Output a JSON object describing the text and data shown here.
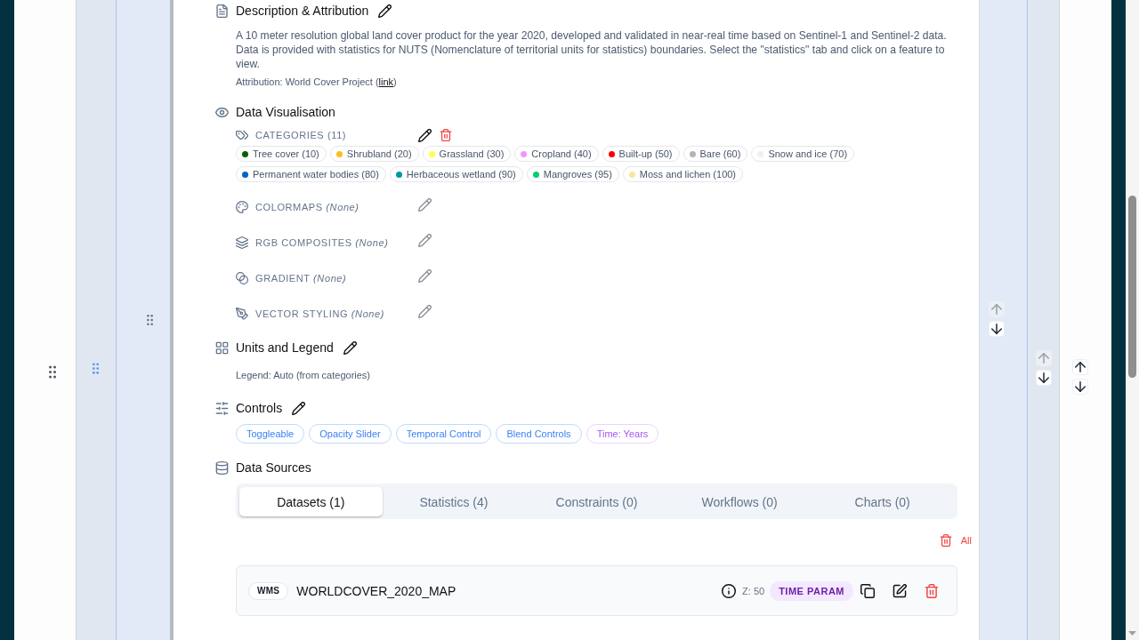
{
  "group": {
    "move_buttons": [
      {
        "kind": "up",
        "disabled": false
      },
      {
        "kind": "down",
        "disabled": false
      }
    ],
    "subgroup": {
      "move_buttons": [
        {
          "kind": "up",
          "disabled": true
        },
        {
          "kind": "down",
          "disabled": false
        }
      ],
      "layer": {
        "move_buttons": [
          {
            "kind": "up",
            "disabled": true
          },
          {
            "kind": "down",
            "disabled": false
          }
        ],
        "description": {
          "title": "Description & Attribution",
          "text": "A 10 meter resolution global land cover product for the year 2020, developed and validated in near-real time based on Sentinel-1 and Sentinel-2 data. Data is provided with statistics for NUTS (Nomenclature of territorial units for statistics) boundaries. Select the \"statistics\" tab and click on a feature to view.",
          "attribution": {
            "prefix": "Attribution: World Cover Project (",
            "link": "link",
            "suffix": ")"
          }
        },
        "visualisation": {
          "title": "Data Visualisation",
          "categories": {
            "label": "CATEGORIES (11)",
            "items": [
              {
                "label": "Tree cover (10)",
                "color": "#006400"
              },
              {
                "label": "Shrubland (20)",
                "color": "#ffbb22"
              },
              {
                "label": "Grassland (30)",
                "color": "#ffff4c"
              },
              {
                "label": "Cropland (40)",
                "color": "#f096ff"
              },
              {
                "label": "Built-up (50)",
                "color": "#fa0000"
              },
              {
                "label": "Bare (60)",
                "color": "#b4b4b4"
              },
              {
                "label": "Snow and ice (70)",
                "color": "#f0f0f0"
              },
              {
                "label": "Permanent water bodies (80)",
                "color": "#0064c8"
              },
              {
                "label": "Herbaceous wetland (90)",
                "color": "#0096a0"
              },
              {
                "label": "Mangroves (95)",
                "color": "#00cf75"
              },
              {
                "label": "Moss and lichen (100)",
                "color": "#fae6a0"
              }
            ]
          },
          "styles": [
            {
              "kind": "colormaps",
              "label": "COLORMAPS *(None)*"
            },
            {
              "kind": "rgb_composites",
              "label": "RGB COMPOSITES *(None)*"
            },
            {
              "kind": "gradient",
              "label": "GRADIENT *(None)*"
            },
            {
              "kind": "vector_styling",
              "label": "VECTOR STYLING *(None)*"
            }
          ]
        },
        "units": {
          "title": "Units and Legend",
          "legend": "Legend: Auto (from categories)"
        },
        "controls": {
          "title": "Controls",
          "tags": [
            {
              "kind": "feature",
              "label": "Toggleable"
            },
            {
              "kind": "feature",
              "label": "Opacity Slider"
            },
            {
              "kind": "feature",
              "label": "Temporal Control"
            },
            {
              "kind": "feature",
              "label": "Blend Controls"
            },
            {
              "kind": "time",
              "label": "Time: Years"
            }
          ]
        },
        "data_sources": {
          "title": "Data Sources",
          "tabs": [
            {
              "label": "Datasets (1)",
              "selected": true
            },
            {
              "label": "Statistics (4)",
              "selected": false
            },
            {
              "label": "Constraints (0)",
              "selected": false
            },
            {
              "label": "Workflows (0)",
              "selected": false
            },
            {
              "label": "Charts (0)",
              "selected": false
            }
          ],
          "delete_all": "All",
          "datasets": [
            {
              "type": "WMS",
              "name": "WORLDCOVER_2020_MAP",
              "zoom": "Z: 50",
              "badge": "TIME PARAM"
            }
          ]
        }
      }
    }
  }
}
